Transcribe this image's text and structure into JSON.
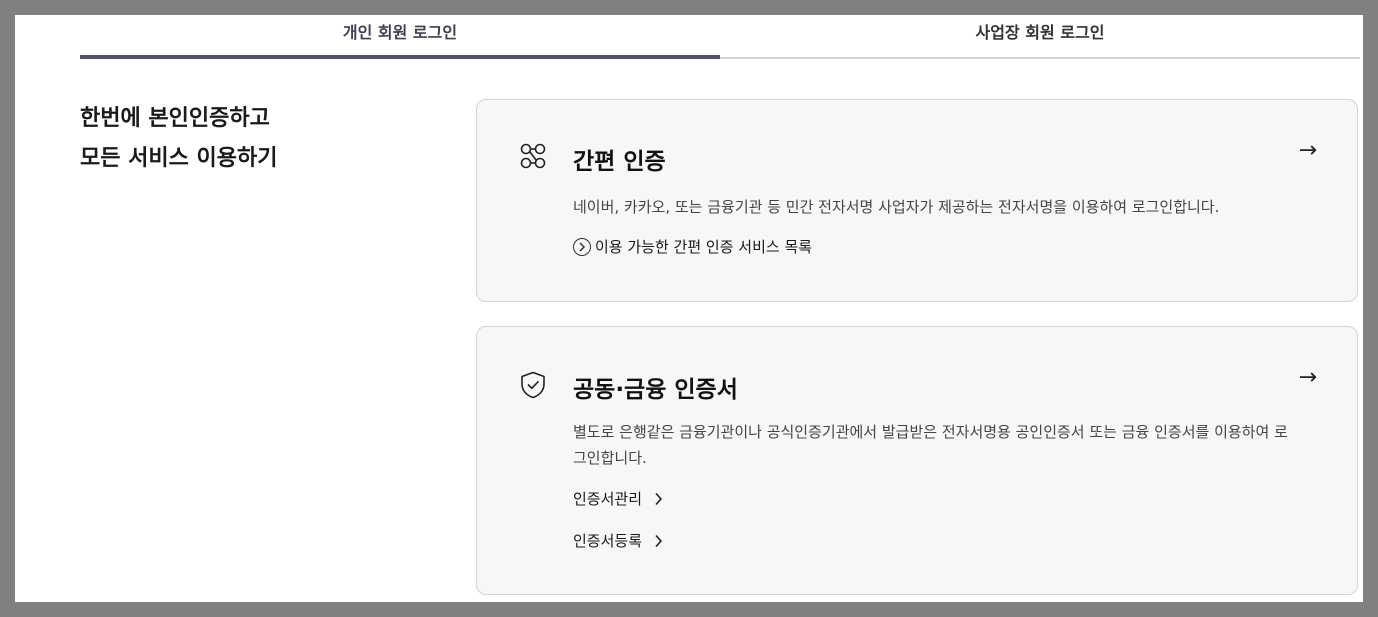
{
  "tabs": {
    "personal": "개인 회원 로그인",
    "business": "사업장 회원 로그인"
  },
  "headline": {
    "line1": "한번에 본인인증하고",
    "line2": "모든 서비스 이용하기"
  },
  "simple_auth": {
    "icon": "link-nodes-icon",
    "title": "간편 인증",
    "arrow": "→",
    "description": "네이버, 카카오, 또는 금융기관 등 민간 전자서명 사업자가 제공하는 전자서명을 이용하여 로그인합니다.",
    "link": "이용 가능한 간편 인증 서비스 목록"
  },
  "cert_auth": {
    "icon": "shield-check-icon",
    "title": "공동·금융 인증서",
    "arrow": "→",
    "description": "별도로 은행같은 금융기관이나 공식인증기관에서 발급받은 전자서명용 공인인증서 또는 금융 인증서를 이용하여 로그인합니다.",
    "link_manage": "인증서관리",
    "link_register": "인증서등록"
  },
  "colors": {
    "active_tab_underline": "#53546b",
    "card_background": "#f7f7f7",
    "card_border": "#d4d4d4"
  }
}
